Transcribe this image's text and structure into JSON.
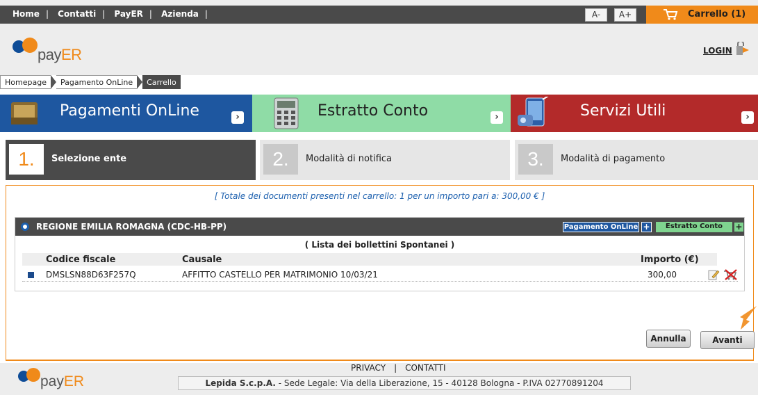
{
  "topnav": {
    "items": [
      "Home",
      "Contatti",
      "PayER",
      "Azienda"
    ],
    "font_decrease": "A-",
    "font_increase": "A+",
    "cart_label": "Carrello (1)"
  },
  "header": {
    "logo_prefix": "pay",
    "logo_suffix": "ER",
    "login": "LOGIN"
  },
  "breadcrumb": [
    "Homepage",
    "Pagamento OnLine",
    "Carrello"
  ],
  "bands": [
    {
      "label": "Pagamenti OnLine",
      "color": "#1e57a0"
    },
    {
      "label": "Estratto Conto",
      "color": "#8fdca6"
    },
    {
      "label": "Servizi Utili",
      "color": "#b32a2a"
    }
  ],
  "steps": [
    {
      "num": "1.",
      "label": "Selezione ente",
      "active": true
    },
    {
      "num": "2.",
      "label": "Modalità di notifica",
      "active": false
    },
    {
      "num": "3.",
      "label": "Modalità di pagamento",
      "active": false
    }
  ],
  "summary": "[ Totale dei documenti presenti nel carrello: 1 per un importo pari a: 300,00 € ]",
  "ente": {
    "name": "REGIONE EMILIA ROMAGNA (CDC-HB-PP)",
    "btn_pagamento": "Pagamento OnLine",
    "btn_estratto": "Estratto Conto",
    "plus": "+",
    "list_title": "( Lista dei bollettini Spontanei )",
    "columns": {
      "codice": "Codice fiscale",
      "causale": "Causale",
      "importo": "Importo (€)"
    },
    "rows": [
      {
        "codice": "DMSLSN88D63F257Q",
        "causale": "AFFITTO CASTELLO PER MATRIMONIO 10/03/21",
        "importo": "300,00"
      }
    ]
  },
  "actions": {
    "annulla": "Annulla",
    "avanti": "Avanti"
  },
  "footer": {
    "privacy": "PRIVACY",
    "contatti": "CONTATTI",
    "separator": "|",
    "company": "Lepida S.c.p.A.",
    "address": "- Sede Legale: Via della Liberazione, 15 - 40128 Bologna - P.IVA 02770891204"
  },
  "colors": {
    "accent_orange": "#f08a1a",
    "brand_blue": "#0e4c97",
    "dark_bar": "#4a4a4a"
  }
}
